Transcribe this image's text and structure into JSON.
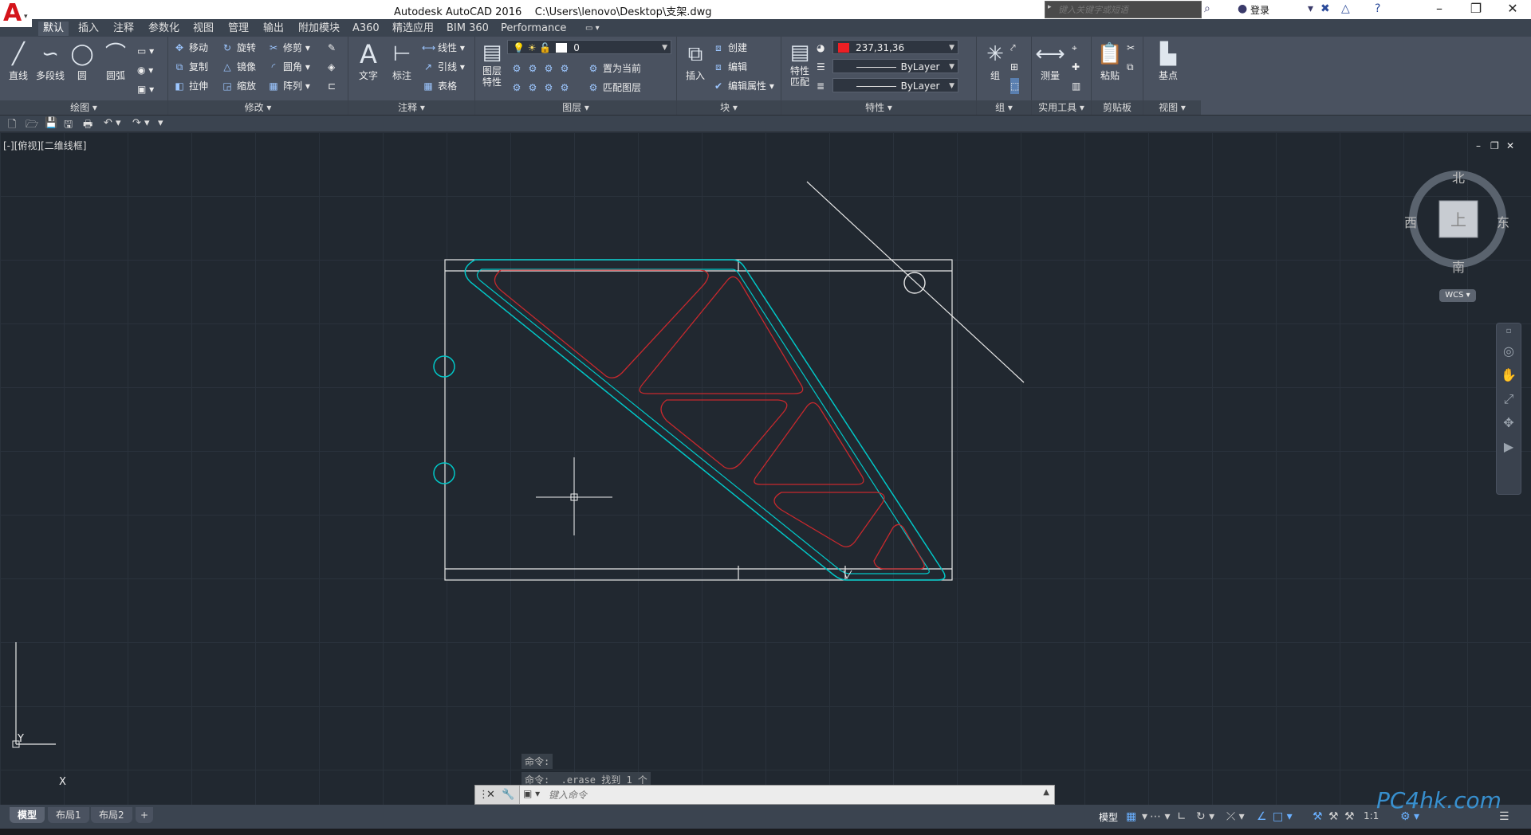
{
  "titlebar": {
    "app": "Autodesk AutoCAD 2016",
    "file": "C:\\Users\\lenovo\\Desktop\\支架.dwg",
    "search_placeholder": "键入关键字或短语",
    "login": "登录"
  },
  "menu_tabs": [
    "默认",
    "插入",
    "注释",
    "参数化",
    "视图",
    "管理",
    "输出",
    "附加模块",
    "A360",
    "精选应用",
    "BIM 360",
    "Performance"
  ],
  "ribbon": {
    "draw": {
      "footer": "绘图 ▾",
      "line": "直线",
      "polyline": "多段线",
      "circle": "圆",
      "arc": "圆弧"
    },
    "modify": {
      "footer": "修改 ▾",
      "move": "移动",
      "rotate": "旋转",
      "trim": "修剪",
      "copy": "复制",
      "mirror": "镜像",
      "fillet": "圆角",
      "stretch": "拉伸",
      "scale": "缩放",
      "array": "阵列"
    },
    "annotation": {
      "footer": "注释 ▾",
      "text": "文字",
      "dimension": "标注",
      "linear": "线性",
      "leader": "引线",
      "table": "表格"
    },
    "layers": {
      "footer": "图层 ▾",
      "layer_props_1": "图层",
      "layer_props_2": "特性",
      "current_layer": "0",
      "set_current": "置为当前",
      "match_layer": "匹配图层"
    },
    "block": {
      "footer": "块 ▾",
      "insert": "插入",
      "create": "创建",
      "edit": "编辑",
      "edit_attr": "编辑属性"
    },
    "properties": {
      "footer": "特性 ▾",
      "match_1": "特性",
      "match_2": "匹配",
      "color": "237,31,36",
      "linetype": "ByLayer",
      "lineweight": "ByLayer"
    },
    "groups": {
      "footer": "组 ▾",
      "group": "组"
    },
    "utilities": {
      "footer": "实用工具 ▾",
      "measure": "测量"
    },
    "clipboard": {
      "footer": "剪贴板",
      "paste": "粘贴"
    },
    "view": {
      "footer": "视图 ▾",
      "base": "基点"
    }
  },
  "viewport": {
    "label": "[-][俯视][二维线框]",
    "compass": {
      "n": "北",
      "s": "南",
      "e": "东",
      "w": "西",
      "top": "上"
    },
    "wcs": "WCS ▾"
  },
  "ucs": {
    "x": "X",
    "y": "Y"
  },
  "command": {
    "history": [
      "命令:",
      "命令: _.erase 找到 1 个"
    ],
    "placeholder": "键入命令"
  },
  "status": {
    "tabs": [
      "模型",
      "布局1",
      "布局2"
    ],
    "model": "模型",
    "scale": "1:1"
  },
  "colors": {
    "accent_red": "#d4141b",
    "cyan": "#00c8c8",
    "red_line": "#c8282d"
  },
  "watermark": "PC4hk.com"
}
